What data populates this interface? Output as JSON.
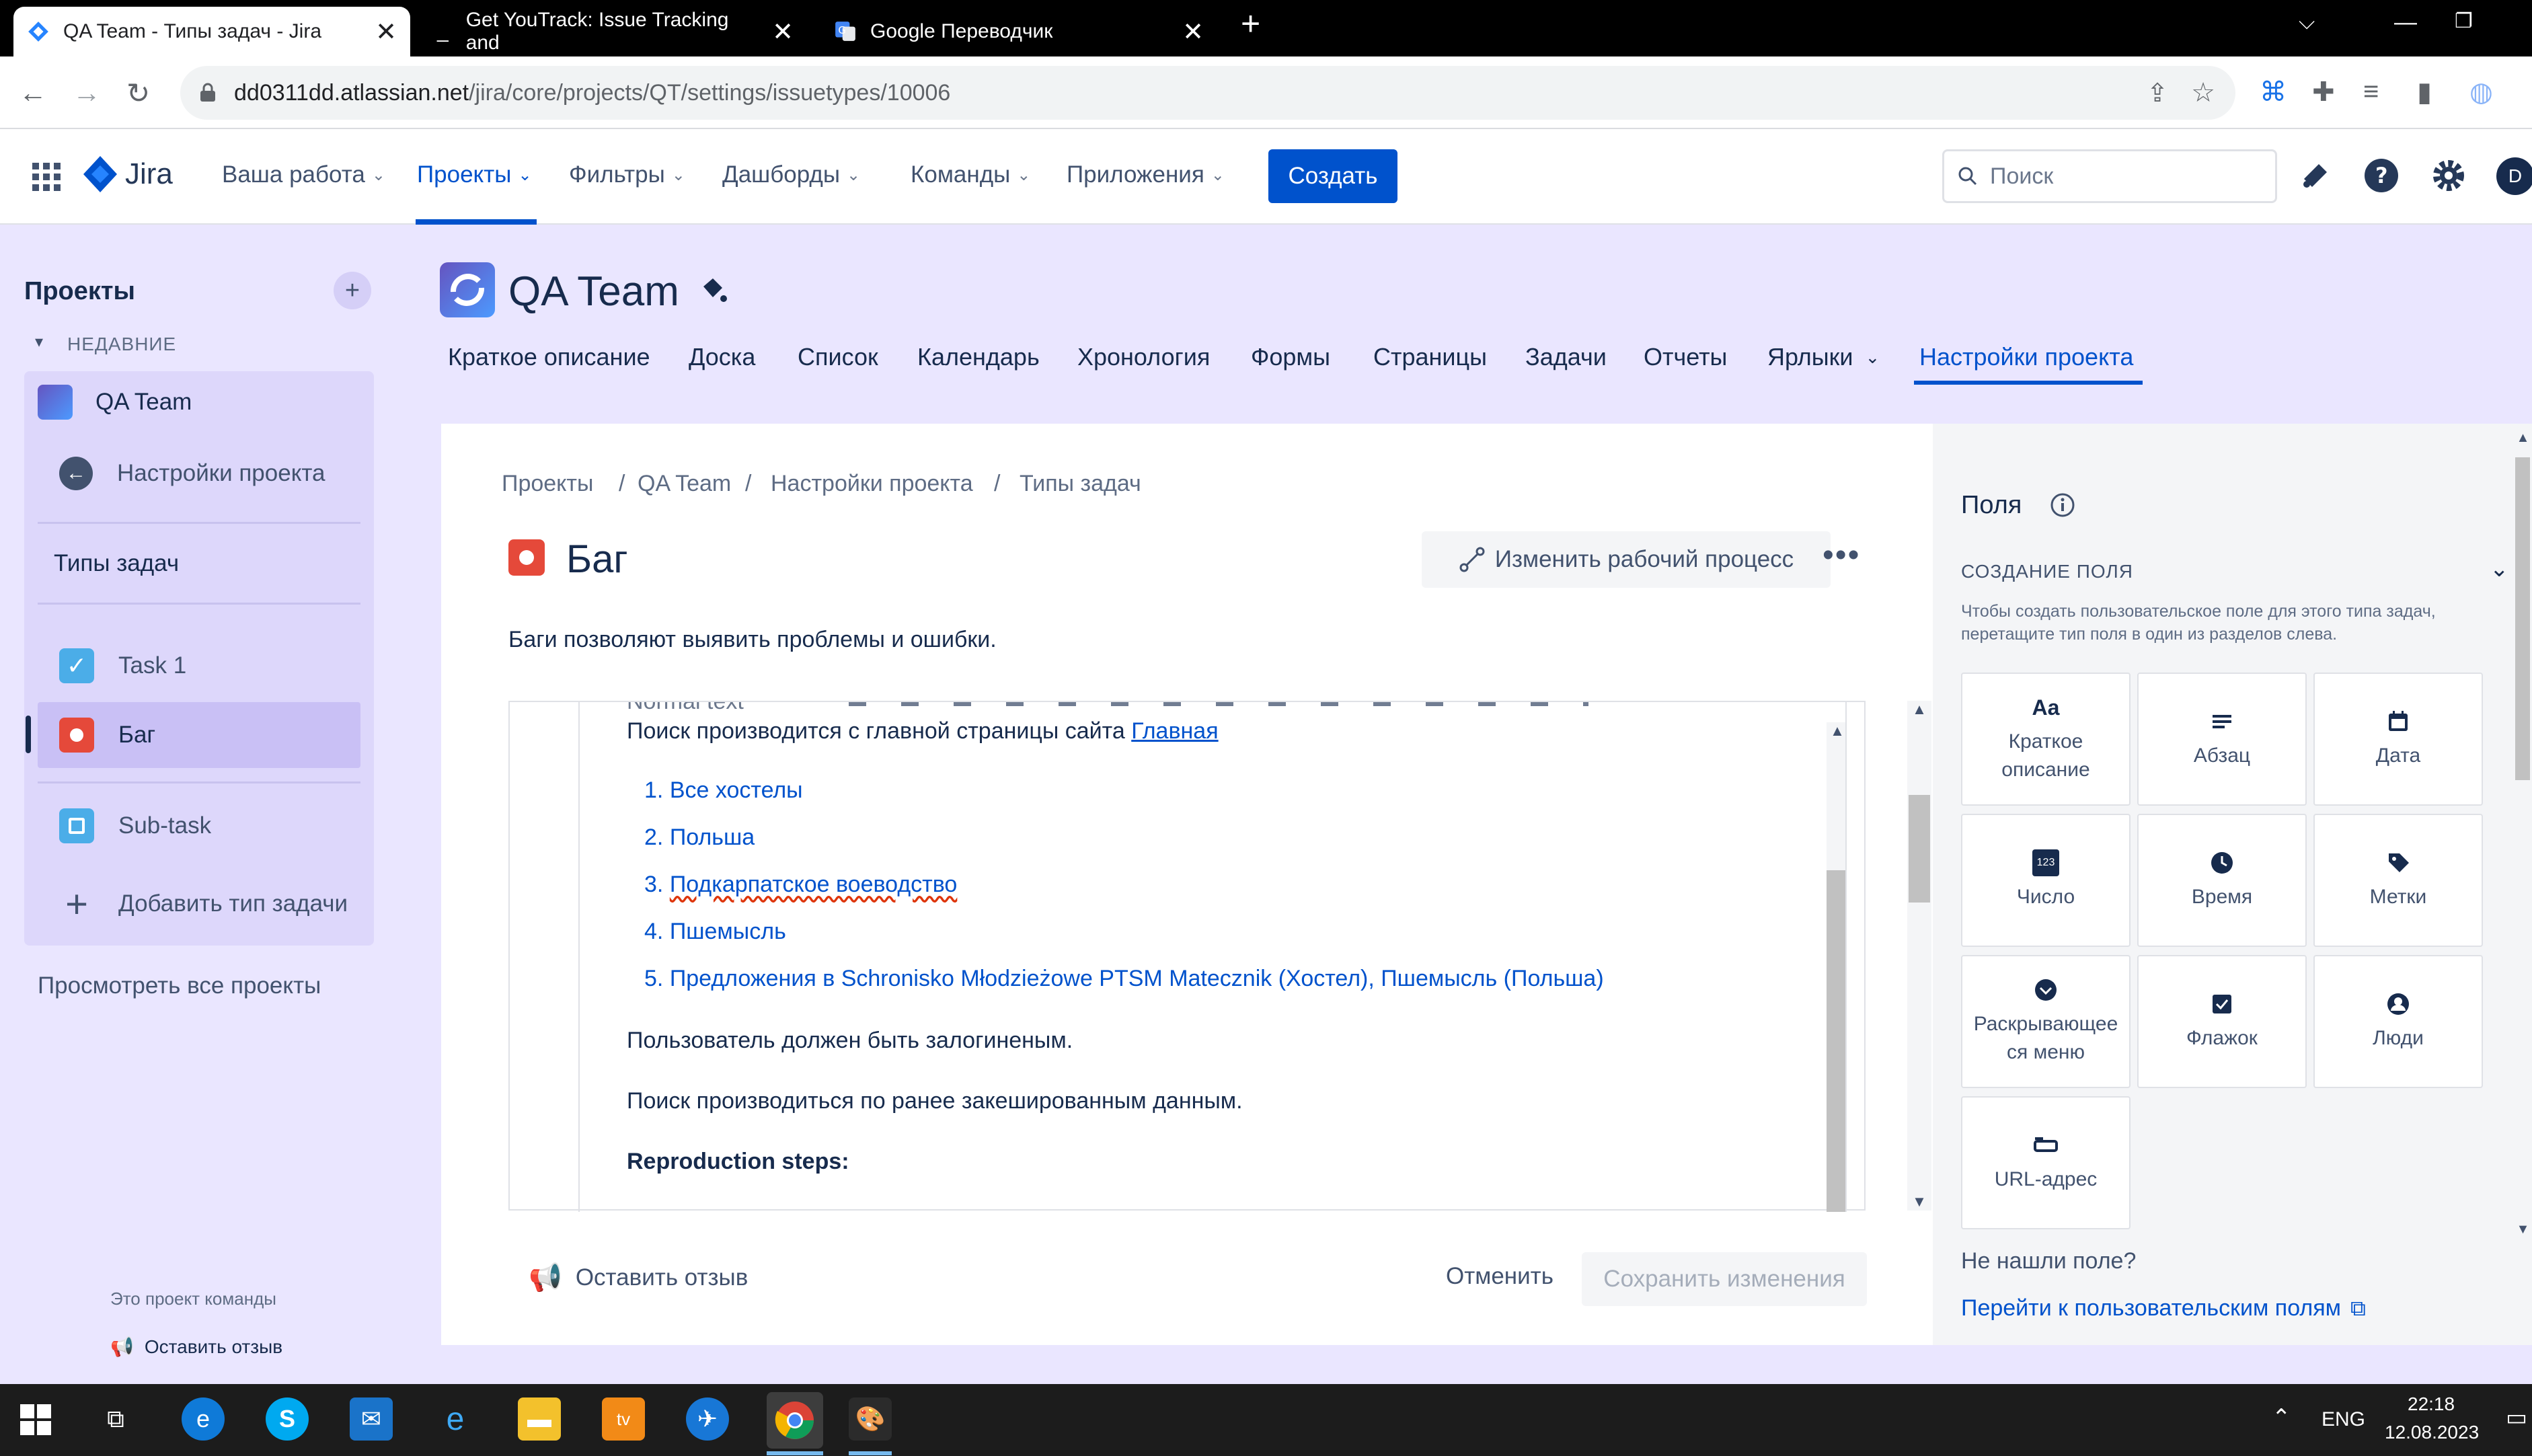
{
  "browser": {
    "tabs": [
      {
        "title": "QA Team - Типы задач - Jira",
        "active": true
      },
      {
        "title": "Get YouTrack: Issue Tracking and",
        "active": false
      },
      {
        "title": "Google Переводчик",
        "active": false
      }
    ],
    "url_host": "dd0311dd.atlassian.net",
    "url_path": "/jira/core/projects/QT/settings/issuetypes/10006"
  },
  "jira_nav": {
    "logo": "Jira",
    "items": [
      "Ваша работа",
      "Проекты",
      "Фильтры",
      "Дашборды",
      "Команды",
      "Приложения"
    ],
    "selected": "Проекты",
    "create_label": "Создать",
    "search_placeholder": "Поиск",
    "avatar_letter": "D"
  },
  "sidebar": {
    "heading": "Проекты",
    "recent_label": "НЕДАВНИЕ",
    "project_name": "QA Team",
    "back_label": "Настройки проекта",
    "section_title": "Типы задач",
    "issue_types": [
      "Task 1",
      "Баг",
      "Sub-task"
    ],
    "add_type": "Добавить тип задачи",
    "view_all": "Просмотреть все проекты",
    "team_note": "Это проект команды",
    "feedback": "Оставить отзыв"
  },
  "project": {
    "title": "QA Team",
    "tabs": [
      "Краткое описание",
      "Доска",
      "Список",
      "Календарь",
      "Хронология",
      "Формы",
      "Страницы",
      "Задачи",
      "Отчеты",
      "Ярлыки",
      "Настройки проекта"
    ],
    "active_tab": "Настройки проекта"
  },
  "main": {
    "breadcrumbs": [
      "Проекты",
      "QA Team",
      "Настройки проекта",
      "Типы задач"
    ],
    "issue_title": "Баг",
    "workflow_button": "Изменить рабочий процесс",
    "description": "Баги позволяют выявить проблемы и ошибки.",
    "editor": {
      "toolbar_text": "Normal text",
      "intro": "Поиск производится с главной страницы сайта",
      "intro_link": "Главная",
      "list": [
        "Все хостелы",
        "Польша",
        "Подкарпатское воеводство",
        "Пшемысль",
        "Предложения в Schronisko Młodzieżowe PTSM Matecznik (Хостел), Пшемысль (Польша)"
      ],
      "para1": "Пользователь должен быть залогиненым.",
      "para2": "Поиск производиться по ранее закешированным данным.",
      "heading": "Reproduction steps:"
    },
    "feedback": "Оставить отзыв",
    "cancel": "Отменить",
    "save": "Сохранить изменения"
  },
  "fields_panel": {
    "title": "Поля",
    "section": "СОЗДАНИЕ ПОЛЯ",
    "hint": "Чтобы создать пользовательское поле для этого типа задач, перетащите тип поля в один из разделов слева.",
    "tiles": [
      {
        "label": "Краткое описание",
        "icon": "text-aa-icon"
      },
      {
        "label": "Абзац",
        "icon": "paragraph-icon"
      },
      {
        "label": "Дата",
        "icon": "calendar-icon"
      },
      {
        "label": "Число",
        "icon": "number-icon"
      },
      {
        "label": "Время",
        "icon": "clock-icon"
      },
      {
        "label": "Метки",
        "icon": "label-icon"
      },
      {
        "label": "Раскрывающее ся меню",
        "icon": "dropdown-icon"
      },
      {
        "label": "Флажок",
        "icon": "checkbox-icon"
      },
      {
        "label": "Люди",
        "icon": "people-icon"
      },
      {
        "label": "URL-адрес",
        "icon": "url-icon"
      }
    ],
    "not_found": "Не нашли поле?",
    "custom_fields_link": "Перейти к пользовательским полям"
  },
  "taskbar": {
    "lang": "ENG",
    "time": "22:18",
    "date": "12.08.2023"
  },
  "colors": {
    "accent": "#0052cc",
    "bug": "#e5493a",
    "task": "#4bade8",
    "sidebar_bg": "#eae6ff"
  }
}
